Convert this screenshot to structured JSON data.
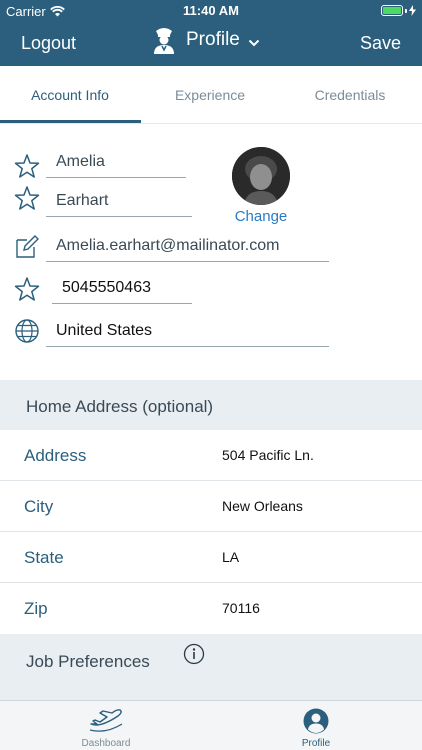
{
  "status_bar": {
    "carrier": "Carrier",
    "time": "11:40 AM",
    "battery_percent": 100
  },
  "nav": {
    "left_label": "Logout",
    "title": "Profile",
    "right_label": "Save"
  },
  "tabs": [
    {
      "label": "Account Info",
      "active": true
    },
    {
      "label": "Experience",
      "active": false
    },
    {
      "label": "Credentials",
      "active": false
    }
  ],
  "profile": {
    "first_name": "Amelia",
    "last_name": "Earhart",
    "email": "Amelia.earhart@mailinator.com",
    "phone": "5045550463",
    "country": "United States",
    "change_label": "Change"
  },
  "home_address": {
    "title": "Home Address (optional)",
    "rows": [
      {
        "label": "Address",
        "value": "504 Pacific Ln."
      },
      {
        "label": "City",
        "value": "New Orleans"
      },
      {
        "label": "State",
        "value": "LA"
      },
      {
        "label": "Zip",
        "value": "70116"
      }
    ]
  },
  "job_preferences": {
    "title": "Job Preferences"
  },
  "tabbar": [
    {
      "label": "Dashboard",
      "icon": "airplane-icon",
      "active": false
    },
    {
      "label": "Profile",
      "icon": "user-icon",
      "active": true
    }
  ],
  "colors": {
    "header": "#2b5f7d",
    "accent": "#2a7bc4",
    "section_bg": "#e9eef2"
  }
}
